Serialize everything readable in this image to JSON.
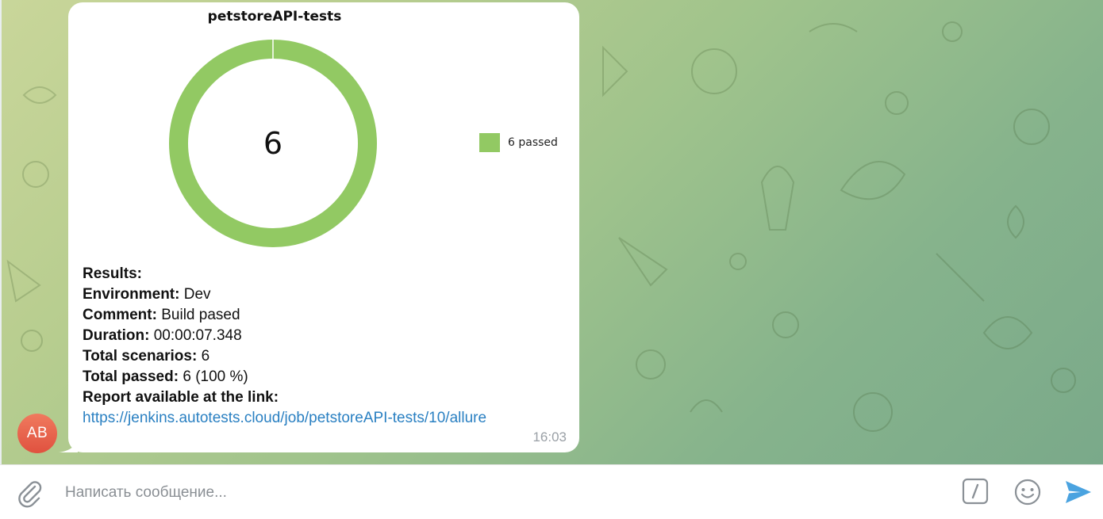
{
  "message": {
    "chart_title": "petstoreAPI-tests",
    "chart_center_label": "6",
    "legend_label": "6 passed",
    "results": {
      "heading": "Results:",
      "environment_label": "Environment:",
      "environment_value": "Dev",
      "comment_label": "Comment:",
      "comment_value": "Build pased",
      "duration_label": "Duration:",
      "duration_value": "00:00:07.348",
      "total_scenarios_label": "Total scenarios:",
      "total_scenarios_value": "6",
      "total_passed_label": "Total passed:",
      "total_passed_value": "6 (100 %)",
      "report_label": "Report available at the link:",
      "report_url": "https://jenkins.autotests.cloud/job/petstoreAPI-tests/10/allure"
    },
    "timestamp": "16:03",
    "sender_initials": "AB"
  },
  "composer": {
    "placeholder": "Написать сообщение..."
  },
  "chart_data": {
    "type": "pie",
    "title": "petstoreAPI-tests",
    "categories": [
      "6 passed"
    ],
    "values": [
      6
    ],
    "center_text": "6",
    "legend_position": "right",
    "colors": [
      "#92c963"
    ]
  },
  "colors": {
    "passed": "#92c963",
    "link": "#2a80c2",
    "send": "#4aa3e0",
    "avatar": "#e45f48"
  },
  "icons": {
    "attach": "paperclip-icon",
    "commands": "slash-command-icon",
    "emoji": "smiley-icon",
    "send": "paper-plane-icon"
  }
}
